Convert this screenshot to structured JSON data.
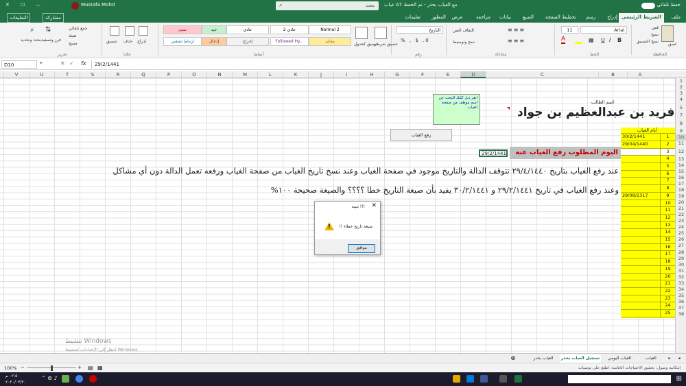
{
  "title_bar": {
    "autosave": "حفظ تلقائي",
    "file_title": "غياب A7 مع الغياب بحذر - تم الحفظ",
    "search": "بحث",
    "user": "Mustafa Mohd"
  },
  "menu": {
    "items": [
      "ملف",
      "الشريط الرئيسي",
      "إدراج",
      "رسم",
      "تخطيط الصفحة",
      "الصيغ",
      "بيانات",
      "مراجعة",
      "عرض",
      "المطور",
      "تعليمات"
    ],
    "share": "مشاركة",
    "comments": "التعليقات"
  },
  "ribbon": {
    "groups": [
      "الحافظة",
      "الخط",
      "محاذاة",
      "رقم",
      "أنماط",
      "خلايا",
      "تحرير"
    ],
    "font_name": "Arial",
    "font_size": "11",
    "number_format": "التاريخ",
    "paste": "لصق",
    "cut": "قص",
    "copy": "نسخ",
    "format_painter": "نسخ التنسيق",
    "wrap_text": "التفاف النص",
    "merge_center": "دمج وتوسيط",
    "conditional_formatting": "تنسيق شرطي",
    "format_as_table": "تنسيق كجدول",
    "insert": "إدراج",
    "delete": "حذف",
    "format": "تنسيق",
    "autosum": "جمع تلقائي",
    "fill": "تعبئة",
    "clear": "مسح",
    "sort_filter": "فرز وتصفية",
    "find_select": "بحث وتحديد",
    "styles": [
      {
        "label": "Normal 2",
        "bg": "#ffffff",
        "color": "#000000"
      },
      {
        "label": "عادي 2",
        "bg": "#ffffff",
        "color": "#000000"
      },
      {
        "label": "عادي",
        "bg": "#ffffff",
        "color": "#000000"
      },
      {
        "label": "جيد",
        "bg": "#c6efce",
        "color": "#006100"
      },
      {
        "label": "سيئ",
        "bg": "#ffc7ce",
        "color": "#9c0006"
      },
      {
        "label": "محايد",
        "bg": "#ffeb9c",
        "color": "#9c5700"
      },
      {
        "label": "Followed Hy...",
        "bg": "#ffffff",
        "color": "#7030a0"
      },
      {
        "label": "إخراج",
        "bg": "#f2f2f2",
        "color": "#3f3f3f"
      },
      {
        "label": "إدخال",
        "bg": "#ffcc99",
        "color": "#3f3f76"
      },
      {
        "label": "ارتباط تشعبي",
        "bg": "#ffffff",
        "color": "#0563c1"
      }
    ]
  },
  "formula_bar": {
    "name_box": "D10",
    "fx": "fx",
    "formula": "29/2/1441"
  },
  "columns": [
    "V",
    "U",
    "T",
    "S",
    "R",
    "Q",
    "P",
    "O",
    "N",
    "M",
    "L",
    "K",
    "J",
    "I",
    "H",
    "G",
    "F",
    "E",
    "D",
    "C",
    "B",
    "A"
  ],
  "selected_column": "D",
  "rows": [
    "1",
    "2",
    "3",
    "4",
    "5",
    "7",
    "8",
    "9",
    "10",
    "11",
    "12",
    "13",
    "14",
    "15",
    "16",
    "17",
    "18",
    "19",
    "20",
    "21",
    "22",
    "23",
    "24",
    "25",
    "26",
    "27",
    "28",
    "29",
    "30",
    "31",
    "32",
    "33",
    "34",
    "35",
    "36",
    "37",
    "38"
  ],
  "selected_row": "10",
  "sheet": {
    "student_label": "اسم الطالب",
    "student_name": "فريد بن عبدالعظيم بن جواد",
    "absence_days_header": "أيام الغياب",
    "absence_entries": [
      {
        "a": "1",
        "b": "30/2/1441"
      },
      {
        "a": "2",
        "b": "29/04/1440"
      },
      {
        "a": "3",
        "b": ""
      },
      {
        "a": "4",
        "b": ""
      },
      {
        "a": "5",
        "b": ""
      },
      {
        "a": "6",
        "b": ""
      },
      {
        "a": "7",
        "b": ""
      },
      {
        "a": "8",
        "b": ""
      },
      {
        "a": "9",
        "b": "29/08/1317"
      },
      {
        "a": "10",
        "b": ""
      },
      {
        "a": "11",
        "b": ""
      },
      {
        "a": "12",
        "b": ""
      },
      {
        "a": "13",
        "b": ""
      },
      {
        "a": "14",
        "b": ""
      },
      {
        "a": "15",
        "b": ""
      },
      {
        "a": "16",
        "b": ""
      },
      {
        "a": "17",
        "b": ""
      },
      {
        "a": "18",
        "b": ""
      },
      {
        "a": "19",
        "b": ""
      },
      {
        "a": "20",
        "b": ""
      },
      {
        "a": "21",
        "b": ""
      },
      {
        "a": "22",
        "b": ""
      },
      {
        "a": "23",
        "b": ""
      },
      {
        "a": "24",
        "b": ""
      },
      {
        "a": "25",
        "b": ""
      }
    ],
    "shape_note": "انقر دبل كليك للبحث عن اسم موظف من صفحة الغياب",
    "remove_absence_button": "رفع الغياب",
    "today_label": "اليوم المطلوب رفع الغياب عنه",
    "today_value": "29/2/1441",
    "note1": "عند رفع الغياب بتاريخ ٢٩/٤/١٤٤٠ تتوقف الدالة والتاريخ موجود في صفحة الغياب   وعند نسخ تاريخ الغياب من صفحة الغياب ورفعه تعمل الدالة دون أي مشاكل",
    "note2": "وعند رفع الغياب في تاريخ ٢٩/٢/١٤٤١ و ٣٠/٢/١٤٤١ يفيد بأن صيغة التاريخ خطا ؟؟؟؟ والصيغة صحيحة ١٠٠%"
  },
  "dialog": {
    "title": "تنبيه !!!",
    "message": "!! صيغة تاريخ خطاء",
    "ok": "موافق"
  },
  "watermark": {
    "line1": "تنشيط Windows",
    "line2": "انتقل إلى الإعدادات لتنشيط Windows."
  },
  "sheet_tabs": [
    "الغياب",
    "الغياب اليومي",
    "تسجيل الغياب بحذر",
    "الغياب بحذر"
  ],
  "active_tab": "تسجيل الغياب بحذر",
  "status": {
    "zoom": "100%",
    "accessibility": "إمكانية وصول: تحقيق الاحتياجات الخاصة: اطلع على توصيات"
  },
  "taskbar": {
    "time": "٠٢:٥٠ م",
    "date": "٢٠٢٠/٠٣/٢٠"
  }
}
